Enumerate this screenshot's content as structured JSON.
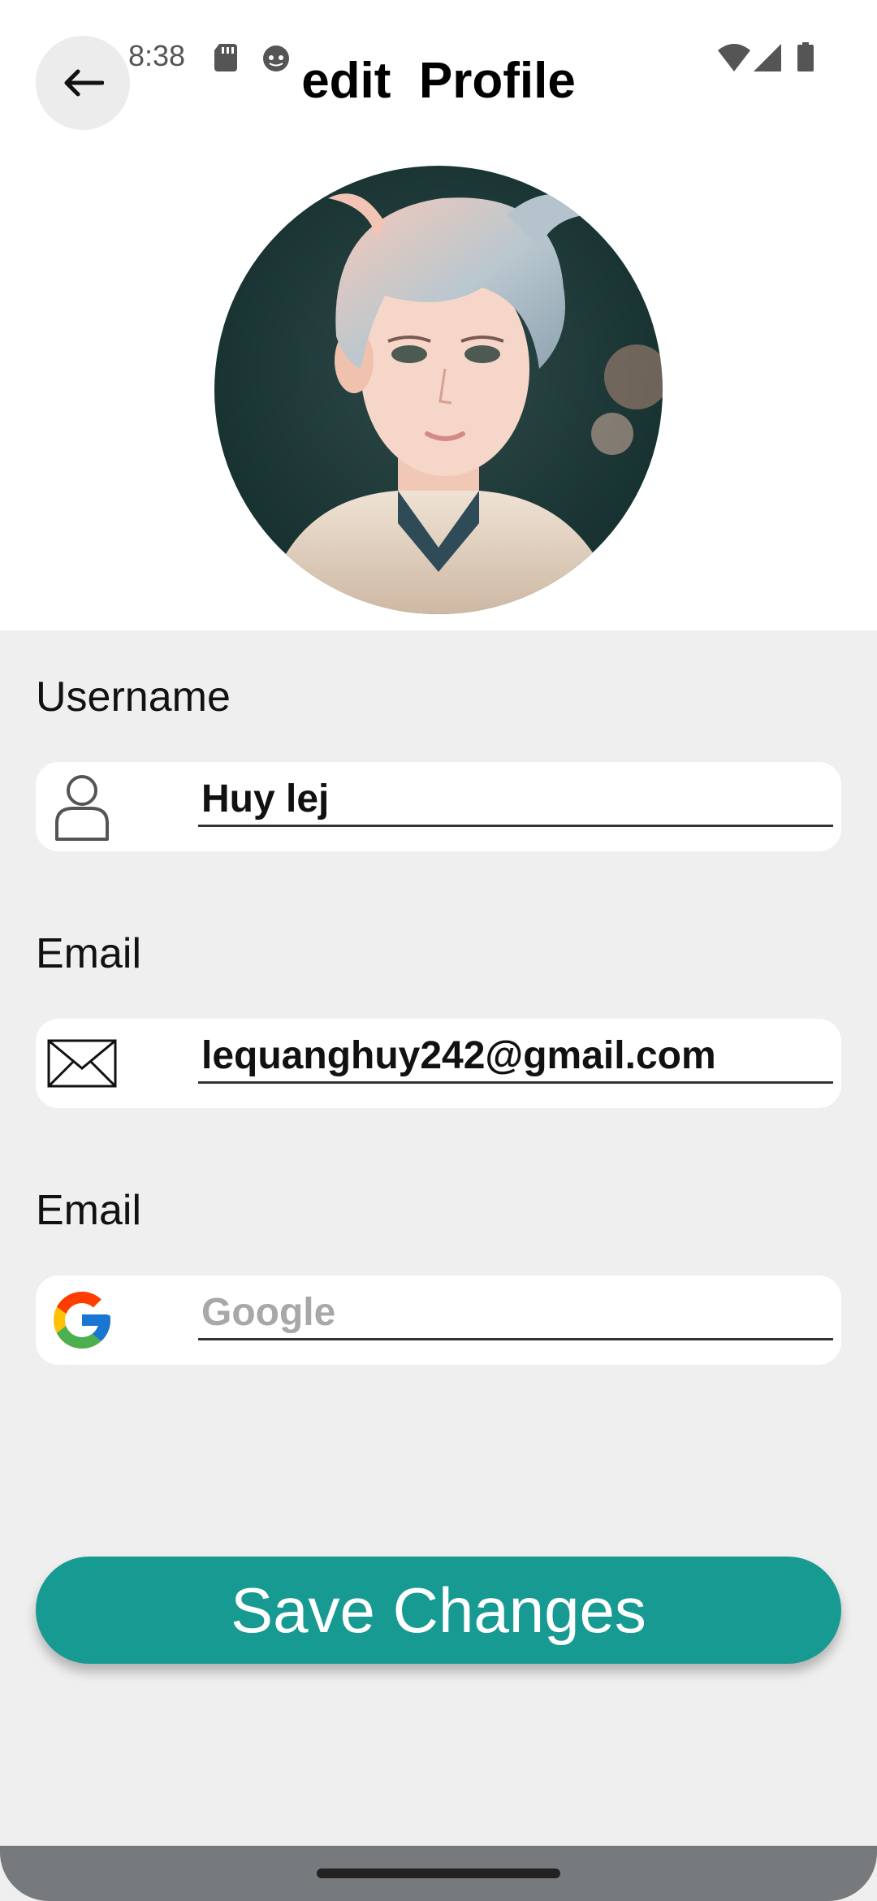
{
  "status_bar": {
    "time": "8:38",
    "icons": [
      "sd-card-icon",
      "face-notification-icon",
      "wifi-icon",
      "signal-icon",
      "battery-icon"
    ]
  },
  "header": {
    "back_icon": "arrow-left-icon",
    "title": "edit  Profile"
  },
  "avatar": {
    "description_icon": "profile-avatar-image"
  },
  "form": {
    "username": {
      "label": "Username",
      "icon": "user-icon",
      "value": "Huy lej",
      "placeholder": ""
    },
    "email": {
      "label": "Email",
      "icon": "envelope-icon",
      "value": "lequanghuy242@gmail.com",
      "placeholder": ""
    },
    "google": {
      "label": "Email",
      "icon": "google-icon",
      "value": "",
      "placeholder": "Google"
    }
  },
  "actions": {
    "save_label": "Save Changes"
  },
  "colors": {
    "accent": "#179a92",
    "background": "#efefef",
    "card": "#ffffff"
  }
}
